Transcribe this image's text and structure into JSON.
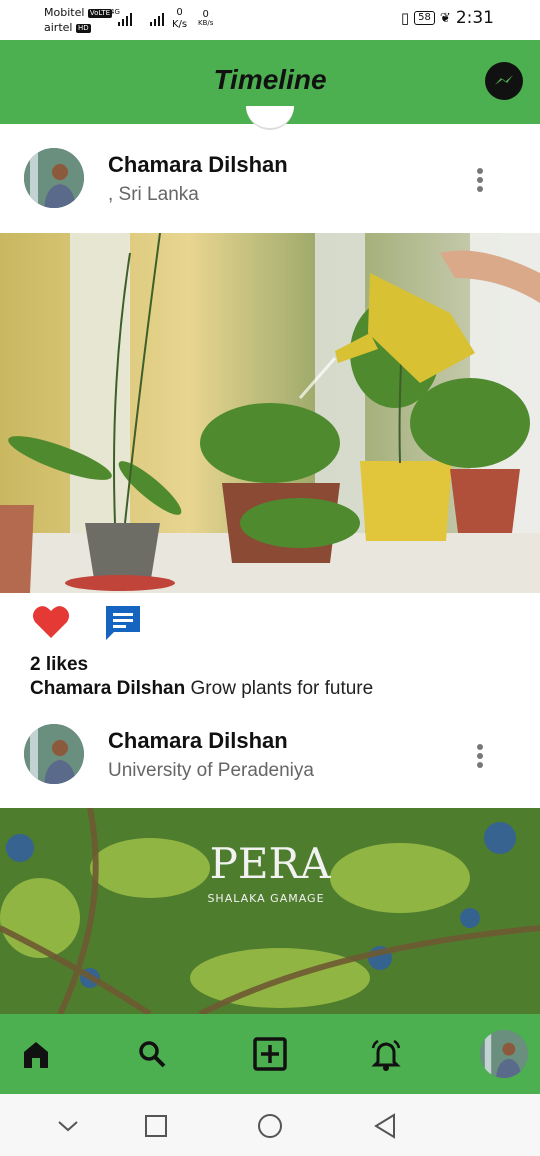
{
  "status_bar": {
    "carrier1": "Mobitel",
    "carrier1_tag": "VoLTE",
    "carrier2": "airtel",
    "carrier2_tag": "HD",
    "network": "4G",
    "speed_value": "0",
    "speed_unit": "K/s",
    "speed_value2": "0",
    "speed_unit2": "KB/s",
    "battery": "58",
    "time": "2:31"
  },
  "app_bar": {
    "title": "Timeline",
    "messenger_icon": "messenger-icon"
  },
  "posts": [
    {
      "user": "Chamara Dilshan",
      "location": ", Sri Lanka",
      "image": "plants-on-windowsill-watering-can",
      "likes": "2 likes",
      "caption_user": "Chamara Dilshan",
      "caption_text": "Grow plants for future"
    },
    {
      "user": "Chamara Dilshan",
      "location": "University of Peradeniya",
      "image": "tree-canopy-photo",
      "watermark_text": "PERA",
      "watermark_sub": "SHALAKA GAMAGE"
    }
  ],
  "bottom_nav": {
    "items": [
      "home-icon",
      "search-icon",
      "add-post-icon",
      "notifications-icon",
      "profile-avatar"
    ]
  },
  "system_nav": {
    "items": [
      "collapse-icon",
      "recents-icon",
      "home-circle-icon",
      "back-icon"
    ]
  },
  "colors": {
    "accent": "#4caf50",
    "like": "#e53935",
    "comment": "#1565c0"
  }
}
